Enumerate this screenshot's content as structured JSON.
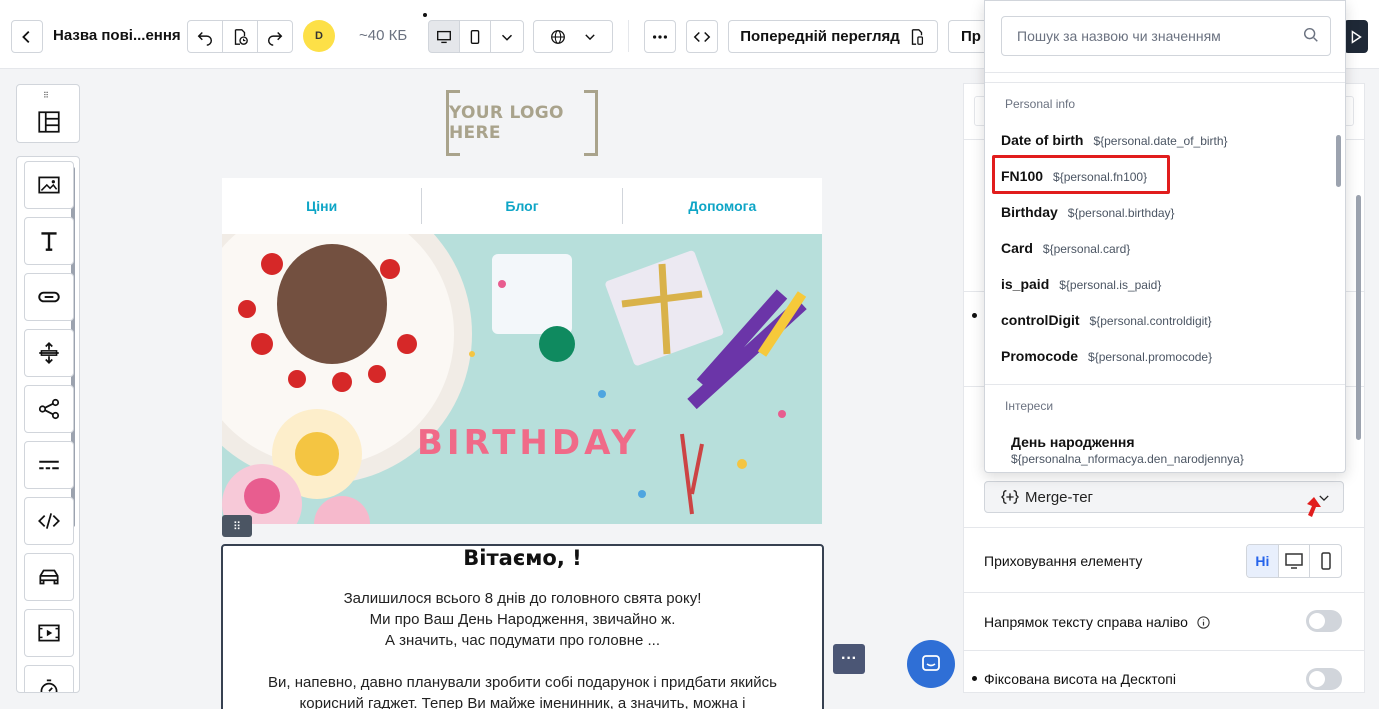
{
  "header": {
    "title": "Назва пові...ення",
    "avatar_initial": "D",
    "size": "~40 КБ",
    "preview_label": "Попередній перегляд",
    "next_label_partial": "Пр"
  },
  "canvas": {
    "logo_text": "YOUR LOGO HERE",
    "nav": [
      "Ціни",
      "Блог",
      "Допомога"
    ],
    "hero_text": "BIRTHDAY",
    "heading": "Вітаємо, !",
    "paragraph1": [
      "Залишилося всього 8 днів до головного свята року!",
      "Ми про Ваш День Народження, звичайно ж.",
      "А значить, час подумати про головне ..."
    ],
    "paragraph2": [
      "Ви, напевно, давно планували зробити собі подарунок і придбати якийсь",
      "корисний гаджет. Тепер Ви майже іменинник, а значить, можна і"
    ]
  },
  "dropdown": {
    "search_placeholder": "Пошук за назвою чи значенням",
    "group_personal": "Personal info",
    "items": [
      {
        "name": "Date of birth",
        "tag": "${personal.date_of_birth}"
      },
      {
        "name": "FN100",
        "tag": "${personal.fn100}"
      },
      {
        "name": "Birthday",
        "tag": "${personal.birthday}"
      },
      {
        "name": "Card",
        "tag": "${personal.card}"
      },
      {
        "name": "is_paid",
        "tag": "${personal.is_paid}"
      },
      {
        "name": "controlDigit",
        "tag": "${personal.controldigit}"
      },
      {
        "name": "Promocode",
        "tag": "${personal.promocode}"
      }
    ],
    "group_interests": "Інтереси",
    "interest_item": {
      "name": "День народження",
      "tag": "${personalna_nformacya.den_narodjennya}"
    }
  },
  "panel": {
    "merge_tag_label": "Merge-тег",
    "hide_label": "Приховування елементу",
    "hide_none": "Ні",
    "rtl_label": "Напрямок тексту справа наліво",
    "fixed_height_label": "Фіксована висота на Десктопі"
  },
  "colors": {
    "accent": "#2563eb",
    "nav_link": "#0ea5c6",
    "highlight": "#e11d1d",
    "logo": "#a9a38c"
  }
}
